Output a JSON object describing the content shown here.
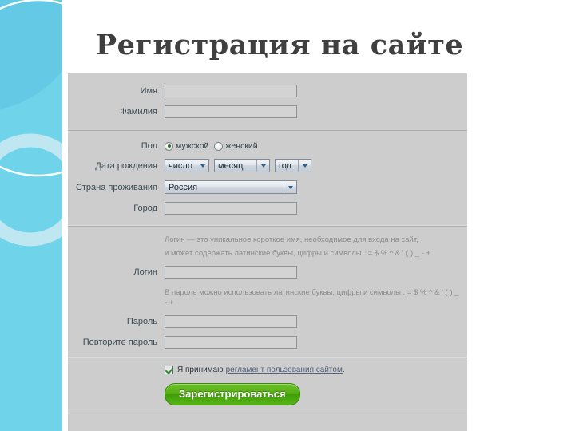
{
  "page": {
    "title": "Регистрация на сайте",
    "background": "#ffffff",
    "accent_band_color": "#6fd3ea",
    "panel_color": "#cdcdcd"
  },
  "form": {
    "sections": [
      {
        "name": "personal",
        "rows": [
          {
            "label": "Имя",
            "type": "text",
            "value": "",
            "placeholder": ""
          },
          {
            "label": "Фамилия",
            "type": "text",
            "value": "",
            "placeholder": ""
          }
        ]
      },
      {
        "name": "details",
        "rows": [
          {
            "label": "Пол",
            "type": "radio"
          },
          {
            "label": "Дата рождения",
            "type": "date"
          },
          {
            "label": "Страна проживания",
            "type": "select"
          },
          {
            "label": "Город",
            "type": "text",
            "value": "",
            "placeholder": ""
          }
        ]
      },
      {
        "name": "credentials",
        "rows": [
          {
            "label": "Логин",
            "type": "text",
            "value": "",
            "placeholder": ""
          },
          {
            "label": "Пароль",
            "type": "text",
            "value": "",
            "placeholder": ""
          },
          {
            "label": "Повторите пароль",
            "type": "text",
            "value": "",
            "placeholder": ""
          }
        ]
      }
    ],
    "gender": {
      "label": "Пол",
      "options": [
        {
          "label": "мужской",
          "selected": true
        },
        {
          "label": "женский",
          "selected": false
        }
      ]
    },
    "birthdate": {
      "label": "Дата рождения",
      "day": "число",
      "month": "месяц",
      "year": "год"
    },
    "country": {
      "label": "Страна проживания",
      "value": "Россия"
    },
    "city": {
      "label": "Город",
      "value": ""
    },
    "login": {
      "label": "Логин",
      "value": "",
      "hint_line1": "Логин — это уникальное короткое имя, необходимое для входа на сайт,",
      "hint_line2": "и может содержать латинские буквы, цифры и символы .!= $ % ^ & ' ( ) _ - +"
    },
    "password": {
      "label": "Пароль",
      "value": "",
      "hint": "В пароле можно использовать латинские буквы, цифры и символы .!= $ % ^ & ' ( ) _ - +"
    },
    "password_repeat": {
      "label": "Повторите пароль",
      "value": ""
    },
    "agreement": {
      "checked": true,
      "text_before": "Я принимаю",
      "link_text": "регламент пользования сайтом",
      "text_after": "."
    },
    "submit": {
      "label": "Зарегистрироваться",
      "color": "#53ad12"
    },
    "first_name": {
      "label": "Имя",
      "value": ""
    },
    "last_name": {
      "label": "Фамилия",
      "value": ""
    }
  }
}
